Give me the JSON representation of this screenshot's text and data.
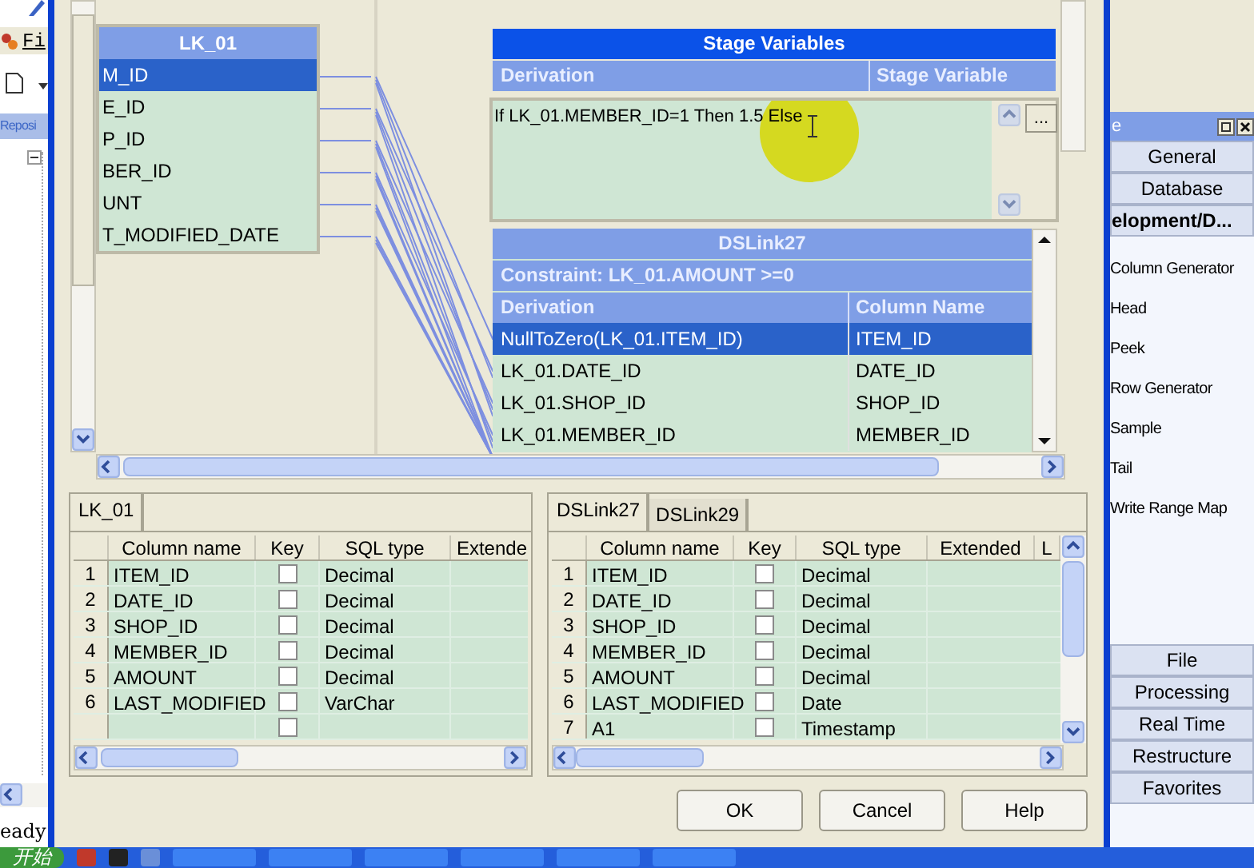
{
  "background_app": {
    "menu": [
      {
        "label": "Fi"
      }
    ],
    "panel_title": "Reposi",
    "status": "eady"
  },
  "mapping_canvas": {
    "input_link": {
      "title": "LK_01",
      "columns": [
        {
          "name": "M_ID",
          "selected": true
        },
        {
          "name": "E_ID",
          "selected": false
        },
        {
          "name": "P_ID",
          "selected": false
        },
        {
          "name": "BER_ID",
          "selected": false
        },
        {
          "name": "UNT",
          "selected": false
        },
        {
          "name": "T_MODIFIED_DATE",
          "selected": false
        }
      ]
    },
    "stage_variables": {
      "title": "Stage Variables",
      "columns": [
        "Derivation",
        "Stage Variable"
      ],
      "expression": "If LK_01.MEMBER_ID=1 Then 1.5 Else ",
      "browse_button": "..."
    },
    "output_link": {
      "title": "DSLink27",
      "constraint": "Constraint: LK_01.AMOUNT >=0",
      "columns": [
        "Derivation",
        "Column Name"
      ],
      "rows": [
        {
          "derivation": "NullToZero(LK_01.ITEM_ID)",
          "column_name": "ITEM_ID",
          "selected": true
        },
        {
          "derivation": "LK_01.DATE_ID",
          "column_name": "DATE_ID",
          "selected": false
        },
        {
          "derivation": "LK_01.SHOP_ID",
          "column_name": "SHOP_ID",
          "selected": false
        },
        {
          "derivation": "LK_01.MEMBER_ID",
          "column_name": "MEMBER_ID",
          "selected": false
        }
      ]
    }
  },
  "input_grid": {
    "tabs": [
      {
        "label": "LK_01",
        "selected": true
      }
    ],
    "columns": [
      "Column name",
      "Key",
      "SQL type",
      "Extende"
    ],
    "rows": [
      {
        "number": "1",
        "column_name": "ITEM_ID",
        "key": false,
        "sql_type": "Decimal"
      },
      {
        "number": "2",
        "column_name": "DATE_ID",
        "key": false,
        "sql_type": "Decimal"
      },
      {
        "number": "3",
        "column_name": "SHOP_ID",
        "key": false,
        "sql_type": "Decimal"
      },
      {
        "number": "4",
        "column_name": "MEMBER_ID",
        "key": false,
        "sql_type": "Decimal"
      },
      {
        "number": "5",
        "column_name": "AMOUNT",
        "key": false,
        "sql_type": "Decimal"
      },
      {
        "number": "6",
        "column_name": "LAST_MODIFIED",
        "key": false,
        "sql_type": "VarChar"
      },
      {
        "key": false
      }
    ]
  },
  "output_grid": {
    "tabs": [
      {
        "label": "DSLink27",
        "selected": true
      },
      {
        "label": "DSLink29",
        "selected": false
      }
    ],
    "columns": [
      "Column name",
      "Key",
      "SQL type",
      "Extended",
      "L"
    ],
    "rows": [
      {
        "number": "1",
        "column_name": "ITEM_ID",
        "key": false,
        "sql_type": "Decimal"
      },
      {
        "number": "2",
        "column_name": "DATE_ID",
        "key": false,
        "sql_type": "Decimal"
      },
      {
        "number": "3",
        "column_name": "SHOP_ID",
        "key": false,
        "sql_type": "Decimal"
      },
      {
        "number": "4",
        "column_name": "MEMBER_ID",
        "key": false,
        "sql_type": "Decimal"
      },
      {
        "number": "5",
        "column_name": "AMOUNT",
        "key": false,
        "sql_type": "Decimal"
      },
      {
        "number": "6",
        "column_name": "LAST_MODIFIED",
        "key": false,
        "sql_type": "Date"
      },
      {
        "number": "7",
        "column_name": "A1",
        "key": false,
        "sql_type": "Timestamp"
      }
    ]
  },
  "buttons": [
    {
      "label": "OK"
    },
    {
      "label": "Cancel"
    },
    {
      "label": "Help"
    }
  ],
  "palette": {
    "title": "e",
    "groups_top": [
      {
        "label": "General",
        "selected": false
      },
      {
        "label": "Database",
        "selected": false
      },
      {
        "label": "elopment/D...",
        "selected": true
      }
    ],
    "items": [
      "Column Generator",
      "Head",
      "Peek",
      "Row Generator",
      "Sample",
      "Tail",
      "Write Range Map"
    ],
    "groups_bottom": [
      {
        "label": "File",
        "selected": false
      },
      {
        "label": "Processing",
        "selected": false
      },
      {
        "label": "Real Time",
        "selected": false
      },
      {
        "label": "Restructure",
        "selected": false
      },
      {
        "label": "Favorites",
        "selected": false
      }
    ]
  },
  "taskbar": {
    "start": "开始"
  }
}
